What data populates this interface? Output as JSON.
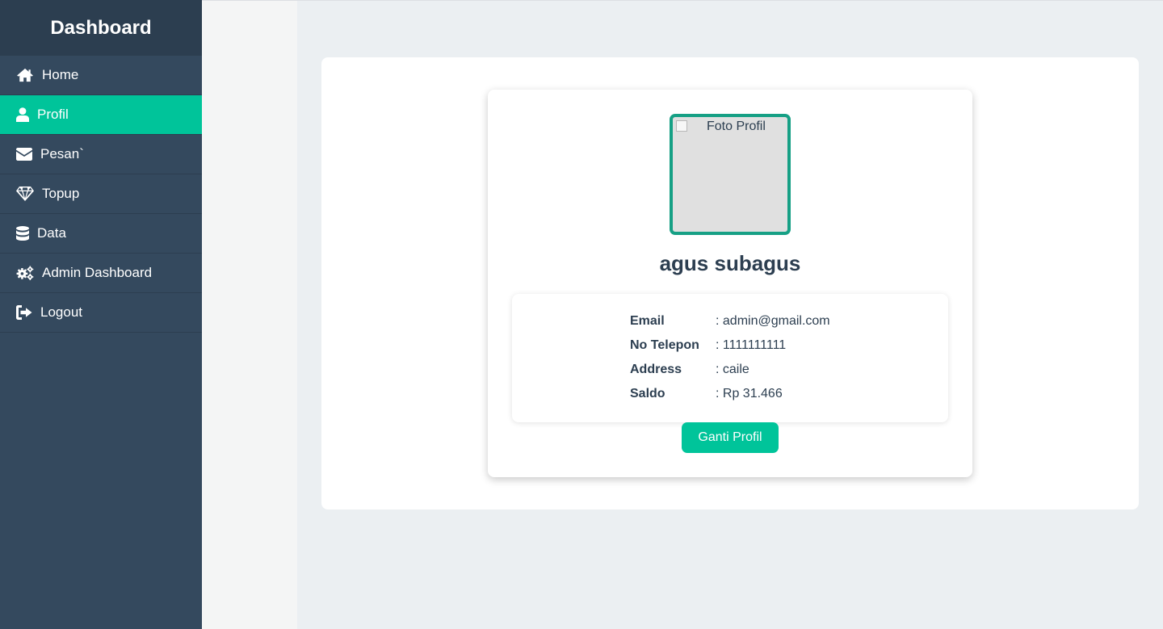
{
  "sidebar": {
    "title": "Dashboard",
    "items": [
      {
        "label": "Home",
        "icon": "home-icon"
      },
      {
        "label": "Profil",
        "icon": "user-icon"
      },
      {
        "label": "Pesan`",
        "icon": "envelope-icon"
      },
      {
        "label": "Topup",
        "icon": "diamond-icon"
      },
      {
        "label": "Data",
        "icon": "database-icon"
      },
      {
        "label": "Admin Dashboard",
        "icon": "cogs-icon"
      },
      {
        "label": "Logout",
        "icon": "logout-icon"
      }
    ],
    "active_index": 1
  },
  "profile": {
    "photo_alt": "Foto Profil",
    "name": "agus subagus",
    "fields": [
      {
        "label": "Email",
        "value": ": admin@gmail.com"
      },
      {
        "label": "No Telepon",
        "value": ": 1111111111"
      },
      {
        "label": "Address",
        "value": ": caile"
      },
      {
        "label": "Saldo",
        "value": ": Rp 31.466"
      }
    ],
    "button_label": "Ganti Profil"
  },
  "colors": {
    "sidebar_bg": "#34495e",
    "sidebar_header_bg": "#2c3e50",
    "accent": "#00c49a",
    "photo_border": "#16a085",
    "text_dark": "#2c3e50"
  }
}
